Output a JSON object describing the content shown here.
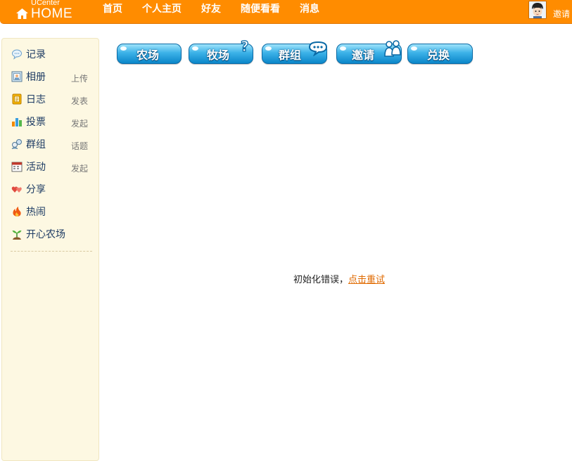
{
  "header": {
    "logo_small": "UCenter",
    "logo_big": "HOME",
    "nav": [
      "首页",
      "个人主页",
      "好友",
      "随便看看",
      "消息"
    ],
    "invite": "邀请",
    "colors": {
      "bar": "#ff8c00",
      "text": "#ffffff"
    }
  },
  "sidebar": {
    "items": [
      {
        "icon": "speech-bubble-icon",
        "label": "记录",
        "action": ""
      },
      {
        "icon": "photo-album-icon",
        "label": "相册",
        "action": "上传"
      },
      {
        "icon": "diary-icon",
        "label": "日志",
        "action": "发表"
      },
      {
        "icon": "bar-chart-icon",
        "label": "投票",
        "action": "发起"
      },
      {
        "icon": "group-icon",
        "label": "群组",
        "action": "话题"
      },
      {
        "icon": "calendar-icon",
        "label": "活动",
        "action": "发起"
      },
      {
        "icon": "share-hearts-icon",
        "label": "分享",
        "action": ""
      },
      {
        "icon": "fire-icon",
        "label": "热闹",
        "action": ""
      },
      {
        "icon": "sprout-icon",
        "label": "开心农场",
        "action": ""
      }
    ]
  },
  "apps": {
    "buttons": [
      "农场",
      "牧场",
      "群组",
      "邀请",
      "兑换"
    ],
    "colors": {
      "top": "#9ee3fb",
      "bottom": "#0b86c9"
    }
  },
  "main": {
    "error_text": "初始化错误，",
    "retry_link": "点击重试",
    "link_color": "#e06a00"
  }
}
